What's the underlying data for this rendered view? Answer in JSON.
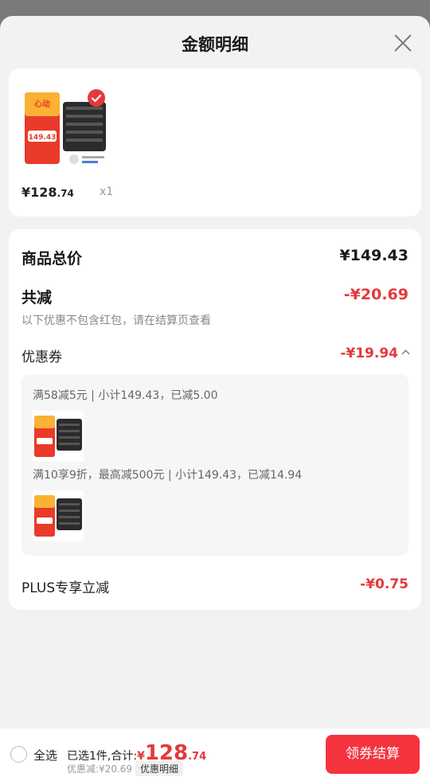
{
  "sheet": {
    "title": "金额明细"
  },
  "product": {
    "price_main": "¥128",
    "price_dec": ".74",
    "quantity": "x1",
    "image_label": "心动好价 149.43"
  },
  "summary": {
    "total_label": "商品总价",
    "total_value": "¥149.43",
    "reduce_label": "共减",
    "reduce_value": "-¥20.69",
    "note": "以下优惠不包含红包，请在结算页查看",
    "coupon_label": "优惠券",
    "coupon_value": "-¥19.94",
    "coupons": [
      {
        "text": "满58减5元 | 小计149.43，已减5.00"
      },
      {
        "text": "满10享9折，最高减500元 | 小计149.43，已减14.94"
      }
    ],
    "plus_label": "PLUS专享立减",
    "plus_value": "-¥0.75"
  },
  "bottom": {
    "select_all": "全选",
    "selected_prefix": "已选1件,合计:",
    "total_yen": "¥",
    "total_int": "128",
    "total_dec": ".74",
    "discount_text": "优惠减:¥20.69",
    "detail_label": "优惠明细",
    "checkout_label": "领券结算"
  },
  "colors": {
    "accent": "#e4393c",
    "button": "#f5333f"
  }
}
